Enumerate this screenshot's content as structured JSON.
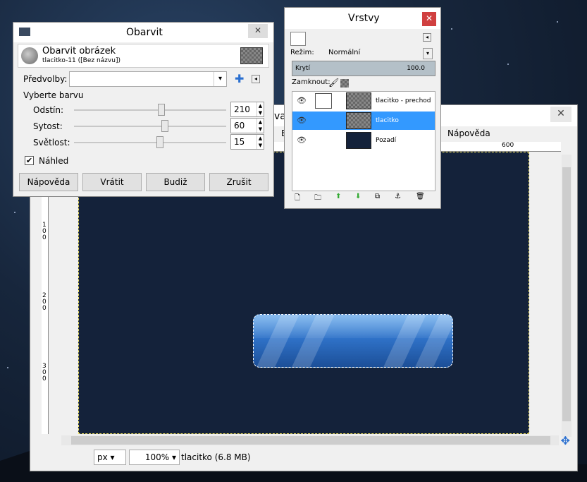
{
  "main": {
    "title": "va",
    "menu_help": "Nápověda",
    "menu_b": "B",
    "ruler_h_600": "600",
    "ruler_v": [
      "1\n0\n0",
      "2\n0\n0",
      "3\n0\n0"
    ],
    "status": {
      "unit": "px",
      "zoom": "100%",
      "text": "tlacitko (6.8 MB)"
    }
  },
  "obarvit": {
    "title": "Obarvit",
    "header_title": "Obarvit obrázek",
    "header_sub": "tlacitko-11 ([Bez názvu])",
    "presets_label": "Předvolby:",
    "section": "Vyberte barvu",
    "sliders": [
      {
        "label": "Odstín:",
        "value": "210",
        "level": 0.58
      },
      {
        "label": "Sytost:",
        "value": "60",
        "level": 0.6
      },
      {
        "label": "Světlost:",
        "value": "15",
        "level": 0.57
      }
    ],
    "preview_label": "Náhled",
    "preview_checked": true,
    "buttons": [
      "Nápověda",
      "Vrátit",
      "Budiž",
      "Zrušit"
    ]
  },
  "vrstvy": {
    "title": "Vrstvy",
    "mode_label": "Režim:",
    "mode_value": "Normální",
    "opacity_label": "Krytí",
    "opacity_value": "100.0",
    "lock_label": "Zamknout:",
    "layers": [
      {
        "name": "tlacitko - prechod",
        "selected": false
      },
      {
        "name": "tlacitko",
        "selected": true
      },
      {
        "name": "Pozadí",
        "selected": false
      }
    ]
  }
}
